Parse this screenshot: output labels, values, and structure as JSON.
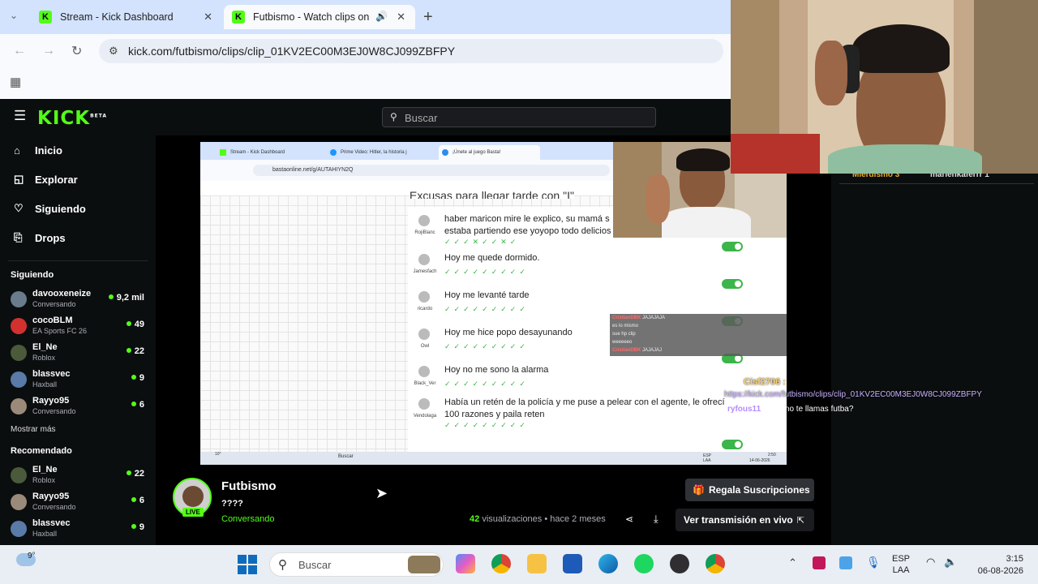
{
  "browser": {
    "tabs": [
      {
        "title": "Stream - Kick Dashboard"
      },
      {
        "title": "Futbismo - Watch clips on K"
      }
    ],
    "url": "kick.com/futbismo/clips/clip_01KV2EC00M3EJ0W8CJ099ZBFPY"
  },
  "kick": {
    "logo": "KICK",
    "logo_sup": "BETA",
    "search_placeholder": "Buscar",
    "nav": [
      {
        "label": "Inicio",
        "icon": "home-icon"
      },
      {
        "label": "Explorar",
        "icon": "compass-icon"
      },
      {
        "label": "Siguiendo",
        "icon": "heart-icon"
      },
      {
        "label": "Drops",
        "icon": "drops-icon"
      }
    ],
    "following_title": "Siguiendo",
    "following": [
      {
        "name": "davooxeneize",
        "game": "Conversando",
        "viewers": "9,2 mil",
        "color": "#6a7b8c"
      },
      {
        "name": "cocoBLM",
        "game": "EA Sports FC 26",
        "viewers": "49",
        "color": "#d33030"
      },
      {
        "name": "El_Ne",
        "game": "Roblox",
        "viewers": "22",
        "color": "#4a5a3a"
      },
      {
        "name": "blassvec",
        "game": "Haxball",
        "viewers": "9",
        "color": "#5a7aa8"
      },
      {
        "name": "Rayyo95",
        "game": "Conversando",
        "viewers": "6",
        "color": "#9a8a7a"
      }
    ],
    "show_more": "Mostrar más",
    "recommended_title": "Recomendado",
    "recommended": [
      {
        "name": "El_Ne",
        "game": "Roblox",
        "viewers": "22",
        "color": "#4a5a3a"
      },
      {
        "name": "Rayyo95",
        "game": "Conversando",
        "viewers": "6",
        "color": "#9a8a7a"
      },
      {
        "name": "blassvec",
        "game": "Haxball",
        "viewers": "9",
        "color": "#5a7aa8"
      }
    ],
    "accent": "#53fc18"
  },
  "clip": {
    "channel": "Futbismo",
    "title": "????",
    "category": "Conversando",
    "live_badge": "LIVE",
    "views_count": "42",
    "views_label": "visualizaciones",
    "ago": "• hace 2 meses",
    "gift_button": "Regala Suscripciones",
    "watch_live": "Ver transmisión en vivo"
  },
  "video": {
    "tabs": [
      "Stream - Kick Dashboard",
      "Prime Video: Hitler, la historia j",
      "¡Únete al juego Basta!"
    ],
    "url": "bastaonline.net/g/AUTAHIYN2Q",
    "heading": "Excusas para llegar tarde con \"I\"",
    "rows": [
      {
        "user": "RojiBlanc",
        "text": "haber maricon mire le explico, su mamá s",
        "text2": "estaba partiendo ese yoyopo todo delicios",
        "checks": "✓✓✓✕✓✓✕✓"
      },
      {
        "user": "Jamesfach",
        "text": "Hoy me quede dormido.",
        "text2": "",
        "checks": "✓✓✓✓✓✓✓✓✓"
      },
      {
        "user": "ricardo",
        "text": "Hoy me levanté tarde",
        "text2": "",
        "checks": "✓✓✓✓✓✓✓✓✓"
      },
      {
        "user": "Owl",
        "text": "Hoy me hice popo desayunando",
        "text2": "",
        "checks": "✓✓✓✓✓✓✓✓✓"
      },
      {
        "user": "Black_Ver",
        "text": "Hoy no me sono la alarma",
        "text2": "",
        "checks": "✓✓✓✓✓✓✓✓✓"
      },
      {
        "user": "Vendolaga",
        "text": "Había un retén de la policía y me puse a pelear con el agente, le ofrecí",
        "text2": "100 razones y paila reten",
        "checks": "✓✓✓✓✓✓✓✓✓"
      }
    ],
    "chat_overlay": [
      {
        "user": "CristianDBK",
        "text": "JAJAJAJA"
      },
      {
        "user": "",
        "text": "es lo mismo"
      },
      {
        "user": "",
        "text": "sue hp clip"
      },
      {
        "user": "",
        "text": "weeeeeo"
      },
      {
        "user": "CristianDBK",
        "text": "JAJAJAJ"
      }
    ],
    "taskbar_search": "Buscar",
    "temp": "10°",
    "tray": "ESP LAA",
    "clock": "2:50",
    "date": "14-06-2026"
  },
  "overlay_chat": {
    "top_users": [
      "Mierdismo 3",
      "marienkaferrr 1"
    ],
    "user1": "Cisf2706 :",
    "link": "https://kick.com/futbismo/clips/clip_01KV2EC00M3EJ0W8CJ099ZBFPY",
    "user2": "ryfous11",
    "message": ": como te llamas futba?"
  },
  "taskbar": {
    "temperature": "9°",
    "search_placeholder": "Buscar",
    "lang": "ESP",
    "region": "LAA",
    "time": "3:15",
    "date": "06-08-2026"
  }
}
